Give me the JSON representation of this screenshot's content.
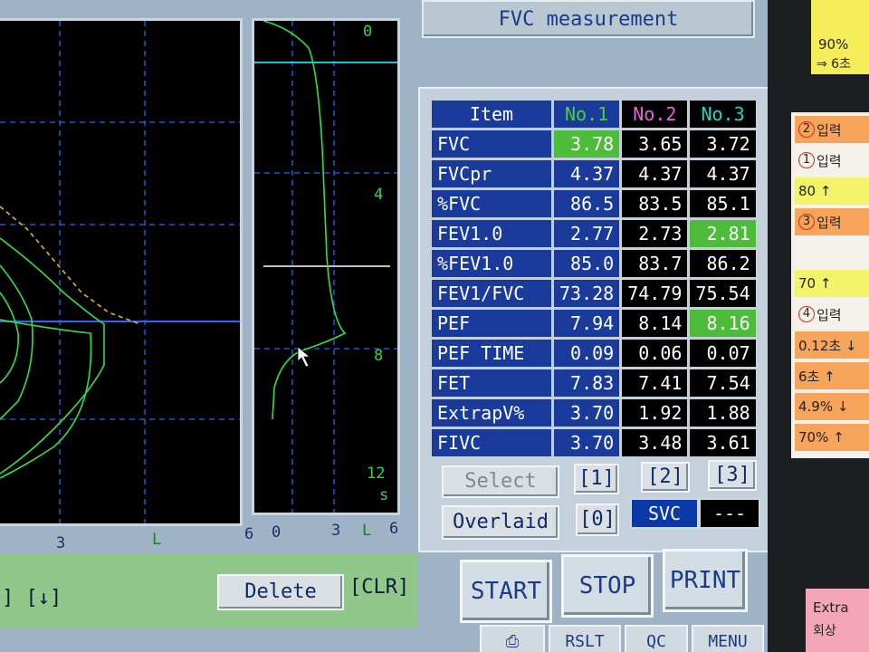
{
  "screen_title": "FVC measurement",
  "graph_left": {
    "axis_labels": [
      "3",
      "L",
      "6"
    ]
  },
  "graph_right": {
    "y_labels": [
      "0",
      "4",
      "8",
      "12",
      "s"
    ],
    "axis_labels": [
      "0",
      "3",
      "L",
      "6"
    ]
  },
  "table": {
    "headers": {
      "item": "Item",
      "no1": "No.1",
      "no2": "No.2",
      "no3": "No.3"
    },
    "header_colors": {
      "no1": "#4cd23c",
      "no2": "#e266d6",
      "no3": "#22d3c4"
    },
    "rows": [
      {
        "label": "FVC",
        "v1": "3.78",
        "v2": "3.65",
        "v3": "3.72",
        "hl": 1
      },
      {
        "label": "FVCpr",
        "v1": "4.37",
        "v2": "4.37",
        "v3": "4.37",
        "hl": 0
      },
      {
        "label": "%FVC",
        "v1": "86.5",
        "v2": "83.5",
        "v3": "85.1",
        "hl": 0
      },
      {
        "label": "FEV1.0",
        "v1": "2.77",
        "v2": "2.73",
        "v3": "2.81",
        "hl": 3
      },
      {
        "label": "%FEV1.0",
        "v1": "85.0",
        "v2": "83.7",
        "v3": "86.2",
        "hl": 0
      },
      {
        "label": "FEV1/FVC",
        "v1": "73.28",
        "v2": "74.79",
        "v3": "75.54",
        "hl": 0
      },
      {
        "label": "PEF",
        "v1": "7.94",
        "v2": "8.14",
        "v3": "8.16",
        "hl": 3
      },
      {
        "label": "PEF TIME",
        "v1": "0.09",
        "v2": "0.06",
        "v3": "0.07",
        "hl": 0
      },
      {
        "label": "FET",
        "v1": "7.83",
        "v2": "7.41",
        "v3": "7.54",
        "hl": 0
      },
      {
        "label": "ExtrapV%",
        "v1": "3.70",
        "v2": "1.92",
        "v3": "1.88",
        "hl": 0
      },
      {
        "label": "FIVC",
        "v1": "3.70",
        "v2": "3.48",
        "v3": "3.61",
        "hl": 0
      }
    ]
  },
  "controls": {
    "select": "Select",
    "overlaid": "Overlaid",
    "b1": "[1]",
    "b2": "[2]",
    "b3": "[3]",
    "b0": "[0]",
    "svc": "SVC",
    "dashes": "---",
    "start": "START",
    "stop": "STOP",
    "print": "PRINT",
    "delete": "Delete",
    "clr": "[CLR]",
    "arrows": "] [↓]"
  },
  "bottom_nav": [
    "⎙",
    "RSLT",
    "QC",
    "MENU"
  ],
  "notes": {
    "yellow_top": [
      "90%",
      "⇒ 6초"
    ],
    "checklist": [
      {
        "num": "2",
        "text": "입력",
        "bg": "#f6a45a"
      },
      {
        "num": "1",
        "text": "입력",
        "bg": "#f4f1ea"
      },
      {
        "num": "",
        "text": "80 ↑",
        "bg": "#f3f36a"
      },
      {
        "num": "3",
        "text": "입력",
        "bg": "#f6a45a"
      },
      {
        "num": "",
        "text": "",
        "bg": "#f4f1ea"
      },
      {
        "num": "",
        "text": "70 ↑",
        "bg": "#f3f36a"
      },
      {
        "num": "4",
        "text": "입력",
        "bg": "#f4f1ea"
      },
      {
        "num": "",
        "text": "0.12초 ↓",
        "bg": "#f6a45a"
      },
      {
        "num": "",
        "text": "6초 ↑",
        "bg": "#f6a45a"
      },
      {
        "num": "",
        "text": "4.9% ↓",
        "bg": "#f6a45a"
      },
      {
        "num": "",
        "text": "70% ↑",
        "bg": "#f6a45a"
      }
    ],
    "pink_bottom": [
      "Extra",
      "회상"
    ]
  }
}
